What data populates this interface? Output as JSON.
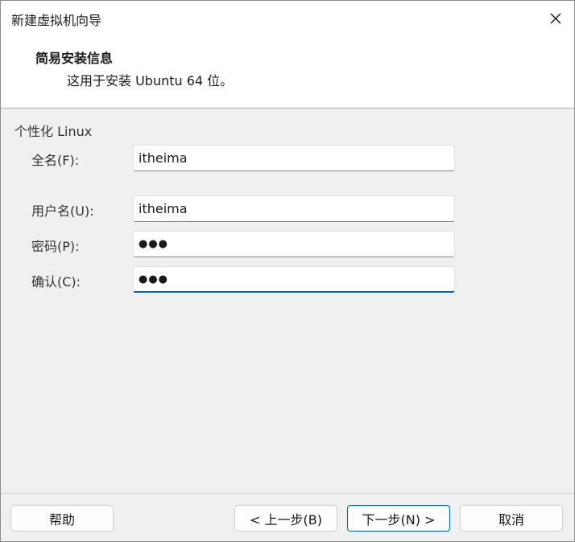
{
  "window": {
    "title": "新建虚拟机向导"
  },
  "header": {
    "title": "简易安装信息",
    "subtitle": "这用于安装 Ubuntu 64 位。"
  },
  "personalize": {
    "group_label": "个性化 Linux",
    "fullname_label": "全名(F):",
    "fullname_value": "itheima",
    "username_label": "用户名(U):",
    "username_value": "itheima",
    "password_label": "密码(P):",
    "password_value": "●●●",
    "confirm_label": "确认(C):",
    "confirm_value": "●●●"
  },
  "footer": {
    "help_label": "帮助",
    "back_label": "< 上一步(B)",
    "next_label": "下一步(N) >",
    "cancel_label": "取消"
  },
  "colors": {
    "accent": "#0067c0",
    "dialog_bg": "#f0f0f0",
    "header_bg": "#ffffff"
  },
  "icons": {
    "close": "close-icon"
  }
}
